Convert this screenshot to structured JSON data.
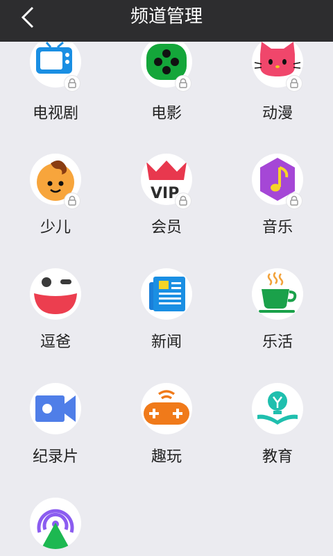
{
  "header": {
    "title": "频道管理",
    "back_icon": "chevron-left-icon"
  },
  "colors": {
    "topbar": "#2d2d2f",
    "background": "#ebebf0"
  },
  "channels": [
    {
      "label": "电视剧",
      "icon": "tv-icon",
      "locked": true
    },
    {
      "label": "电影",
      "icon": "film-reel-icon",
      "locked": true
    },
    {
      "label": "动漫",
      "icon": "cat-face-icon",
      "locked": true
    },
    {
      "label": "少儿",
      "icon": "child-face-icon",
      "locked": true
    },
    {
      "label": "会员",
      "icon": "vip-crown-icon",
      "locked": true
    },
    {
      "label": "音乐",
      "icon": "music-note-icon",
      "locked": true
    },
    {
      "label": "逗爸",
      "icon": "winking-smile-icon",
      "locked": false
    },
    {
      "label": "新闻",
      "icon": "newspaper-icon",
      "locked": false
    },
    {
      "label": "乐活",
      "icon": "tea-cup-icon",
      "locked": false
    },
    {
      "label": "纪录片",
      "icon": "video-camera-icon",
      "locked": false
    },
    {
      "label": "趣玩",
      "icon": "gamepad-icon",
      "locked": false
    },
    {
      "label": "教育",
      "icon": "book-bulb-icon",
      "locked": false
    },
    {
      "label": "",
      "icon": "broadcast-icon",
      "locked": false
    }
  ]
}
